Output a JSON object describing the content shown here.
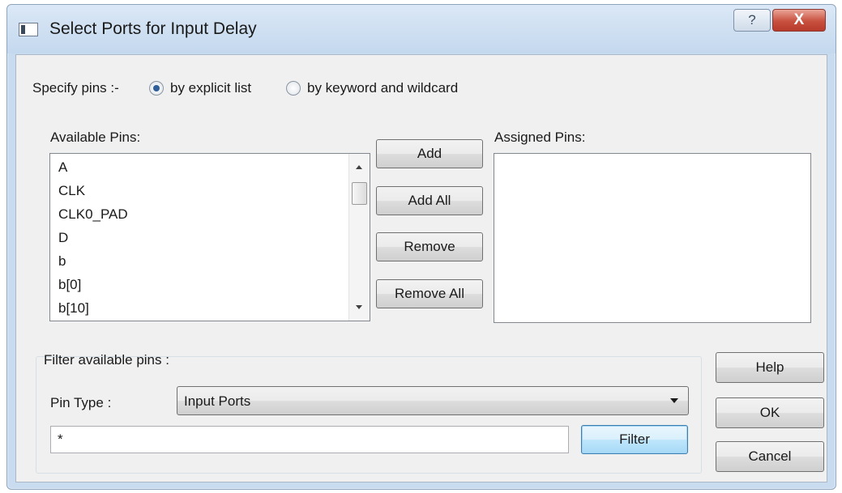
{
  "window": {
    "title": "Select Ports for Input Delay",
    "help_glyph": "?",
    "close_glyph": "X"
  },
  "specify": {
    "label": "Specify pins :-",
    "options": [
      {
        "label": "by explicit list",
        "checked": true
      },
      {
        "label": "by keyword and wildcard",
        "checked": false
      }
    ]
  },
  "available": {
    "label": "Available Pins:",
    "items": [
      "A",
      "CLK",
      "CLK0_PAD",
      "D",
      "b",
      "b[0]",
      "b[10]"
    ]
  },
  "assigned": {
    "label": "Assigned Pins:",
    "items": []
  },
  "actions": {
    "add": "Add",
    "add_all": "Add All",
    "remove": "Remove",
    "remove_all": "Remove All"
  },
  "filter": {
    "group_label": "Filter available pins :",
    "pin_type_label": "Pin Type :",
    "pin_type_value": "Input Ports",
    "pattern_value": "*",
    "filter_button": "Filter"
  },
  "dialog_buttons": {
    "help": "Help",
    "ok": "OK",
    "cancel": "Cancel"
  }
}
